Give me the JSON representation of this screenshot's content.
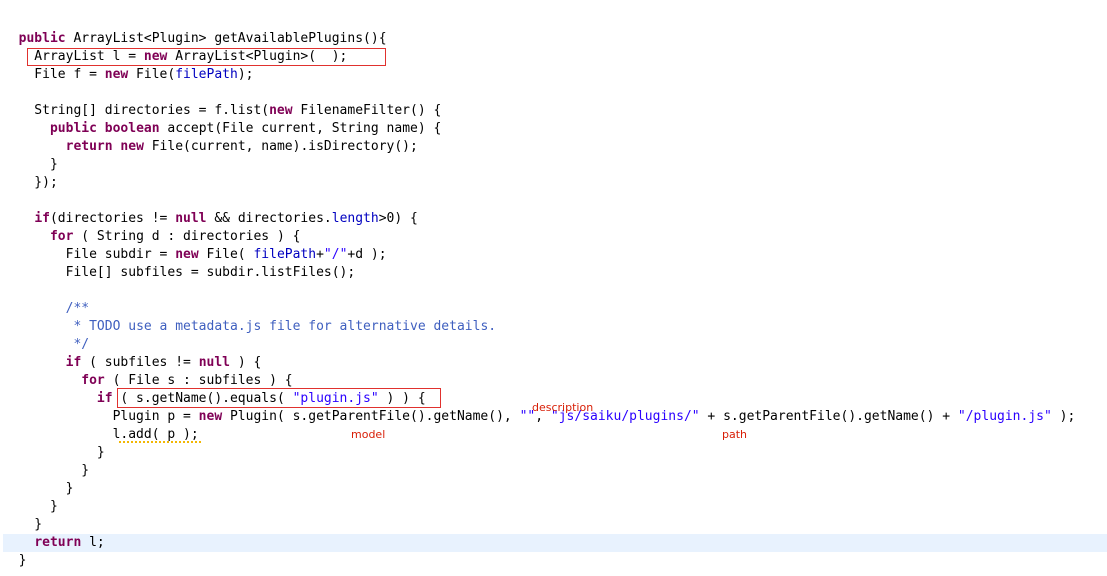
{
  "code": {
    "lines": [
      [
        {
          "t": "  "
        },
        {
          "t": "public",
          "c": "kw"
        },
        {
          "t": " ArrayList<Plugin> getAvailablePlugins(){"
        }
      ],
      [
        {
          "t": "    ArrayList l = "
        },
        {
          "t": "new",
          "c": "kw"
        },
        {
          "t": " ArrayList<Plugin>(  );"
        }
      ],
      [
        {
          "t": "    File f = "
        },
        {
          "t": "new",
          "c": "kw"
        },
        {
          "t": " File("
        },
        {
          "t": "filePath",
          "c": "fld"
        },
        {
          "t": ");"
        }
      ],
      [
        {
          "t": ""
        }
      ],
      [
        {
          "t": "    String[] directories = f.list("
        },
        {
          "t": "new",
          "c": "kw"
        },
        {
          "t": " FilenameFilter() {"
        }
      ],
      [
        {
          "t": "      "
        },
        {
          "t": "public",
          "c": "kw"
        },
        {
          "t": " "
        },
        {
          "t": "boolean",
          "c": "kw"
        },
        {
          "t": " accept(File current, String name) {"
        }
      ],
      [
        {
          "t": "        "
        },
        {
          "t": "return",
          "c": "kw"
        },
        {
          "t": " "
        },
        {
          "t": "new",
          "c": "kw"
        },
        {
          "t": " File(current, name).isDirectory();"
        }
      ],
      [
        {
          "t": "      }"
        }
      ],
      [
        {
          "t": "    });"
        }
      ],
      [
        {
          "t": ""
        }
      ],
      [
        {
          "t": "    "
        },
        {
          "t": "if",
          "c": "kw"
        },
        {
          "t": "(directories != "
        },
        {
          "t": "null",
          "c": "kw"
        },
        {
          "t": " && directories."
        },
        {
          "t": "length",
          "c": "fld"
        },
        {
          "t": ">0) {"
        }
      ],
      [
        {
          "t": "      "
        },
        {
          "t": "for",
          "c": "kw"
        },
        {
          "t": " ( String d : directories ) {"
        }
      ],
      [
        {
          "t": "        File subdir = "
        },
        {
          "t": "new",
          "c": "kw"
        },
        {
          "t": " File( "
        },
        {
          "t": "filePath",
          "c": "fld"
        },
        {
          "t": "+"
        },
        {
          "t": "\"/\"",
          "c": "str"
        },
        {
          "t": "+d );"
        }
      ],
      [
        {
          "t": "        File[] subfiles = subdir.listFiles();"
        }
      ],
      [
        {
          "t": ""
        }
      ],
      [
        {
          "t": "        "
        },
        {
          "t": "/**",
          "c": "cmt"
        }
      ],
      [
        {
          "t": "         "
        },
        {
          "t": "* TODO use a metadata.js file for alternative details.",
          "c": "cmt"
        }
      ],
      [
        {
          "t": "         "
        },
        {
          "t": "*/",
          "c": "cmt"
        }
      ],
      [
        {
          "t": "        "
        },
        {
          "t": "if",
          "c": "kw"
        },
        {
          "t": " ( subfiles != "
        },
        {
          "t": "null",
          "c": "kw"
        },
        {
          "t": " ) {"
        }
      ],
      [
        {
          "t": "          "
        },
        {
          "t": "for",
          "c": "kw"
        },
        {
          "t": " ( File s : subfiles ) {"
        }
      ],
      [
        {
          "t": "            "
        },
        {
          "t": "if",
          "c": "kw"
        },
        {
          "t": " ( s.getName().equals( "
        },
        {
          "t": "\"plugin.js\"",
          "c": "str"
        },
        {
          "t": " ) ) {"
        }
      ],
      [
        {
          "t": "              Plugin p = "
        },
        {
          "t": "new",
          "c": "kw"
        },
        {
          "t": " Plugin( s.getParentFile().getName(), "
        },
        {
          "t": "\"\"",
          "c": "str"
        },
        {
          "t": ", "
        },
        {
          "t": "\"js/saiku/plugins/\"",
          "c": "str"
        },
        {
          "t": " + s.getParentFile().getName() + "
        },
        {
          "t": "\"/plugin.js\"",
          "c": "str"
        },
        {
          "t": " );"
        }
      ],
      [
        {
          "t": "              l.add( p );"
        }
      ],
      [
        {
          "t": "            }"
        }
      ],
      [
        {
          "t": "          }"
        }
      ],
      [
        {
          "t": "        }"
        }
      ],
      [
        {
          "t": "      }"
        }
      ],
      [
        {
          "t": "    }"
        }
      ],
      [
        {
          "t": "    "
        },
        {
          "t": "return",
          "c": "kw"
        },
        {
          "t": " l;"
        }
      ],
      [
        {
          "t": "  }"
        }
      ]
    ]
  },
  "annotations": {
    "model": "model",
    "description": "description",
    "path": "path"
  },
  "colors": {
    "keyword": "#7f0055",
    "string": "#2a00ff",
    "field": "#0000c0",
    "comment": "#3f5fbf",
    "annotation": "#d81e06",
    "current_line": "#e8f2fe"
  }
}
